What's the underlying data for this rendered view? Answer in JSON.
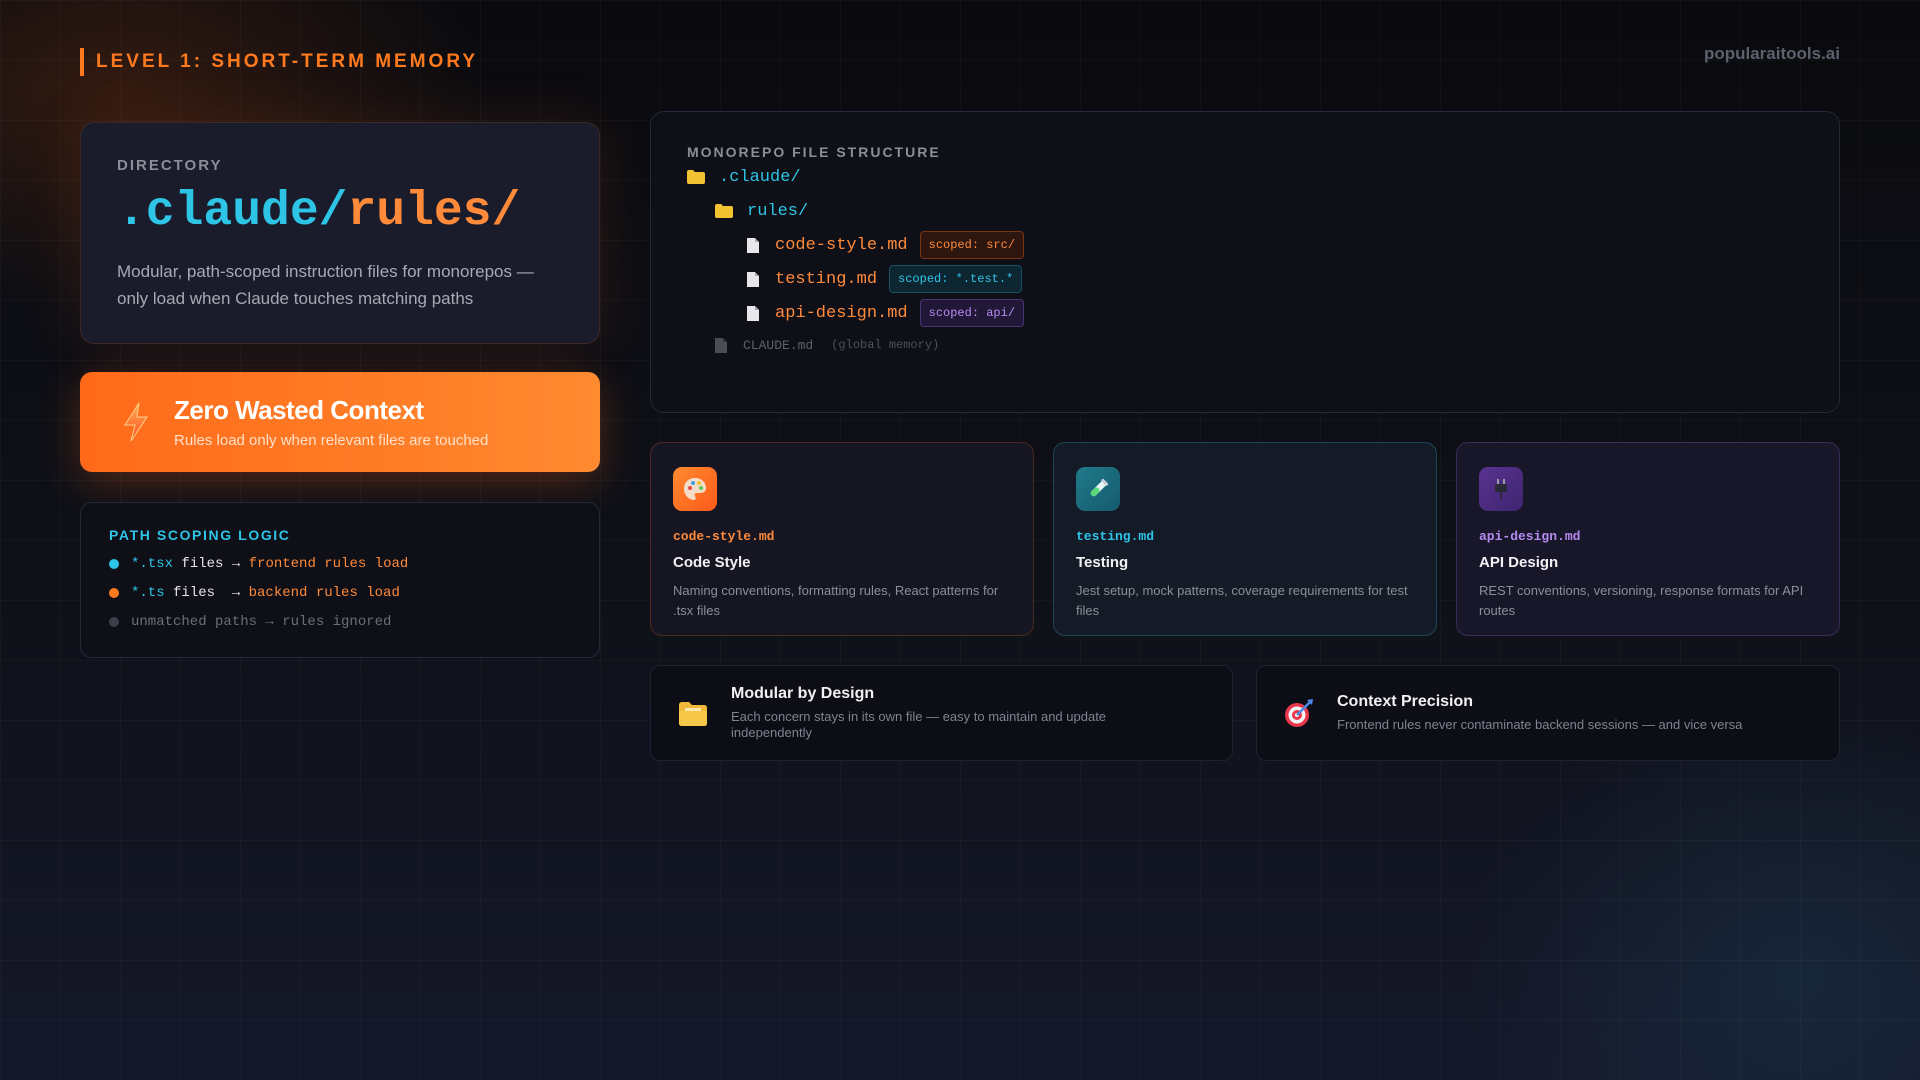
{
  "header": {
    "title": "LEVEL 1: SHORT-TERM MEMORY",
    "brand": "popularaitools.ai"
  },
  "directory": {
    "label": "DIRECTORY",
    "path_part1": ".claude/",
    "path_part2": "rules/",
    "description": "Modular, path-scoped instruction files for monorepos — only load when Claude touches matching paths"
  },
  "highlight": {
    "title": "Zero Wasted Context",
    "subtitle": "Rules load only when relevant files are touched",
    "icon": "lightning-icon"
  },
  "scoping": {
    "title": "PATH SCOPING LOGIC",
    "rows": [
      {
        "pattern": "*.tsx",
        "middle": " files → ",
        "result": "frontend rules load",
        "color": "#2ec4e6"
      },
      {
        "pattern": "*.ts",
        "middle": " files  → ",
        "result": "backend rules load",
        "color": "#ff7a1f"
      },
      {
        "pattern": "",
        "middle": "",
        "result": "unmatched paths → rules ignored",
        "color": "#5d616d"
      }
    ]
  },
  "tree": {
    "title": "MONOREPO FILE STRUCTURE",
    "root": ".claude/",
    "sub": "rules/",
    "files": [
      {
        "name": "code-style.md",
        "tag": "scoped: src/"
      },
      {
        "name": "testing.md",
        "tag": "scoped: *.test.*"
      },
      {
        "name": "api-design.md",
        "tag": "scoped: api/"
      }
    ],
    "global_file": "CLAUDE.md",
    "global_note": "(global memory)"
  },
  "rule_cards": [
    {
      "file": "code-style.md",
      "title": "Code Style",
      "desc": "Naming conventions, formatting rules, React patterns for .tsx files",
      "icon": "palette-icon"
    },
    {
      "file": "testing.md",
      "title": "Testing",
      "desc": "Jest setup, mock patterns, coverage requirements for test files",
      "icon": "test-tube-icon"
    },
    {
      "file": "api-design.md",
      "title": "API Design",
      "desc": "REST conventions, versioning, response formats for API routes",
      "icon": "plug-icon"
    }
  ],
  "bottom_cards": [
    {
      "title": "Modular by Design",
      "desc": "Each concern stays in its own file — easy to maintain and update independently",
      "icon": "folder-icon"
    },
    {
      "title": "Context Precision",
      "desc": "Frontend rules never contaminate backend sessions — and vice versa",
      "icon": "target-icon"
    }
  ],
  "colors": {
    "accent_orange": "#ff7a1f",
    "accent_teal": "#2ec4e6",
    "accent_purple": "#b58bf0",
    "background": "#0b0c12"
  }
}
